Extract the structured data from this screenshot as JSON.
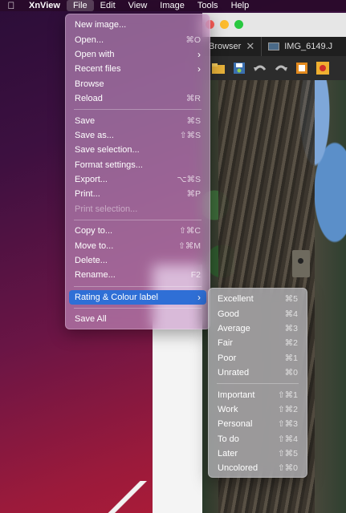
{
  "menubar": {
    "app_name": "XnView",
    "items": [
      "File",
      "Edit",
      "View",
      "Image",
      "Tools",
      "Help"
    ]
  },
  "window": {
    "tabs": [
      {
        "label": "Browser"
      },
      {
        "label": "IMG_6149.J"
      }
    ]
  },
  "file_menu": {
    "groups": [
      [
        {
          "label": "New image...",
          "shortcut": ""
        },
        {
          "label": "Open...",
          "shortcut": "⌘O"
        },
        {
          "label": "Open with",
          "shortcut": "",
          "submenu": true
        },
        {
          "label": "Recent files",
          "shortcut": "",
          "submenu": true
        },
        {
          "label": "Browse",
          "shortcut": ""
        },
        {
          "label": "Reload",
          "shortcut": "⌘R"
        }
      ],
      [
        {
          "label": "Save",
          "shortcut": "⌘S"
        },
        {
          "label": "Save as...",
          "shortcut": "⇧⌘S"
        },
        {
          "label": "Save selection...",
          "shortcut": ""
        },
        {
          "label": "Format settings...",
          "shortcut": ""
        },
        {
          "label": "Export...",
          "shortcut": "⌥⌘S"
        },
        {
          "label": "Print...",
          "shortcut": "⌘P"
        },
        {
          "label": "Print selection...",
          "shortcut": "",
          "disabled": true
        }
      ],
      [
        {
          "label": "Copy to...",
          "shortcut": "⇧⌘C"
        },
        {
          "label": "Move to...",
          "shortcut": "⇧⌘M"
        },
        {
          "label": "Delete...",
          "shortcut": ""
        },
        {
          "label": "Rename...",
          "shortcut": "F2"
        }
      ],
      [
        {
          "label": "Rating & Colour label",
          "shortcut": "",
          "submenu": true,
          "highlight": true
        }
      ],
      [
        {
          "label": "Save All",
          "shortcut": ""
        }
      ]
    ]
  },
  "rating_submenu": {
    "groups": [
      [
        {
          "label": "Excellent",
          "shortcut": "⌘5"
        },
        {
          "label": "Good",
          "shortcut": "⌘4"
        },
        {
          "label": "Average",
          "shortcut": "⌘3"
        },
        {
          "label": "Fair",
          "shortcut": "⌘2"
        },
        {
          "label": "Poor",
          "shortcut": "⌘1"
        },
        {
          "label": "Unrated",
          "shortcut": "⌘0"
        }
      ],
      [
        {
          "label": "Important",
          "shortcut": "⇧⌘1"
        },
        {
          "label": "Work",
          "shortcut": "⇧⌘2"
        },
        {
          "label": "Personal",
          "shortcut": "⇧⌘3"
        },
        {
          "label": "To do",
          "shortcut": "⇧⌘4"
        },
        {
          "label": "Later",
          "shortcut": "⇧⌘5"
        },
        {
          "label": "Uncolored",
          "shortcut": "⇧⌘0"
        }
      ]
    ]
  },
  "colors": {
    "highlight": "#2f6fd6",
    "traffic_red": "#fe5f57",
    "traffic_yellow": "#febc2e",
    "traffic_green": "#28c840"
  }
}
